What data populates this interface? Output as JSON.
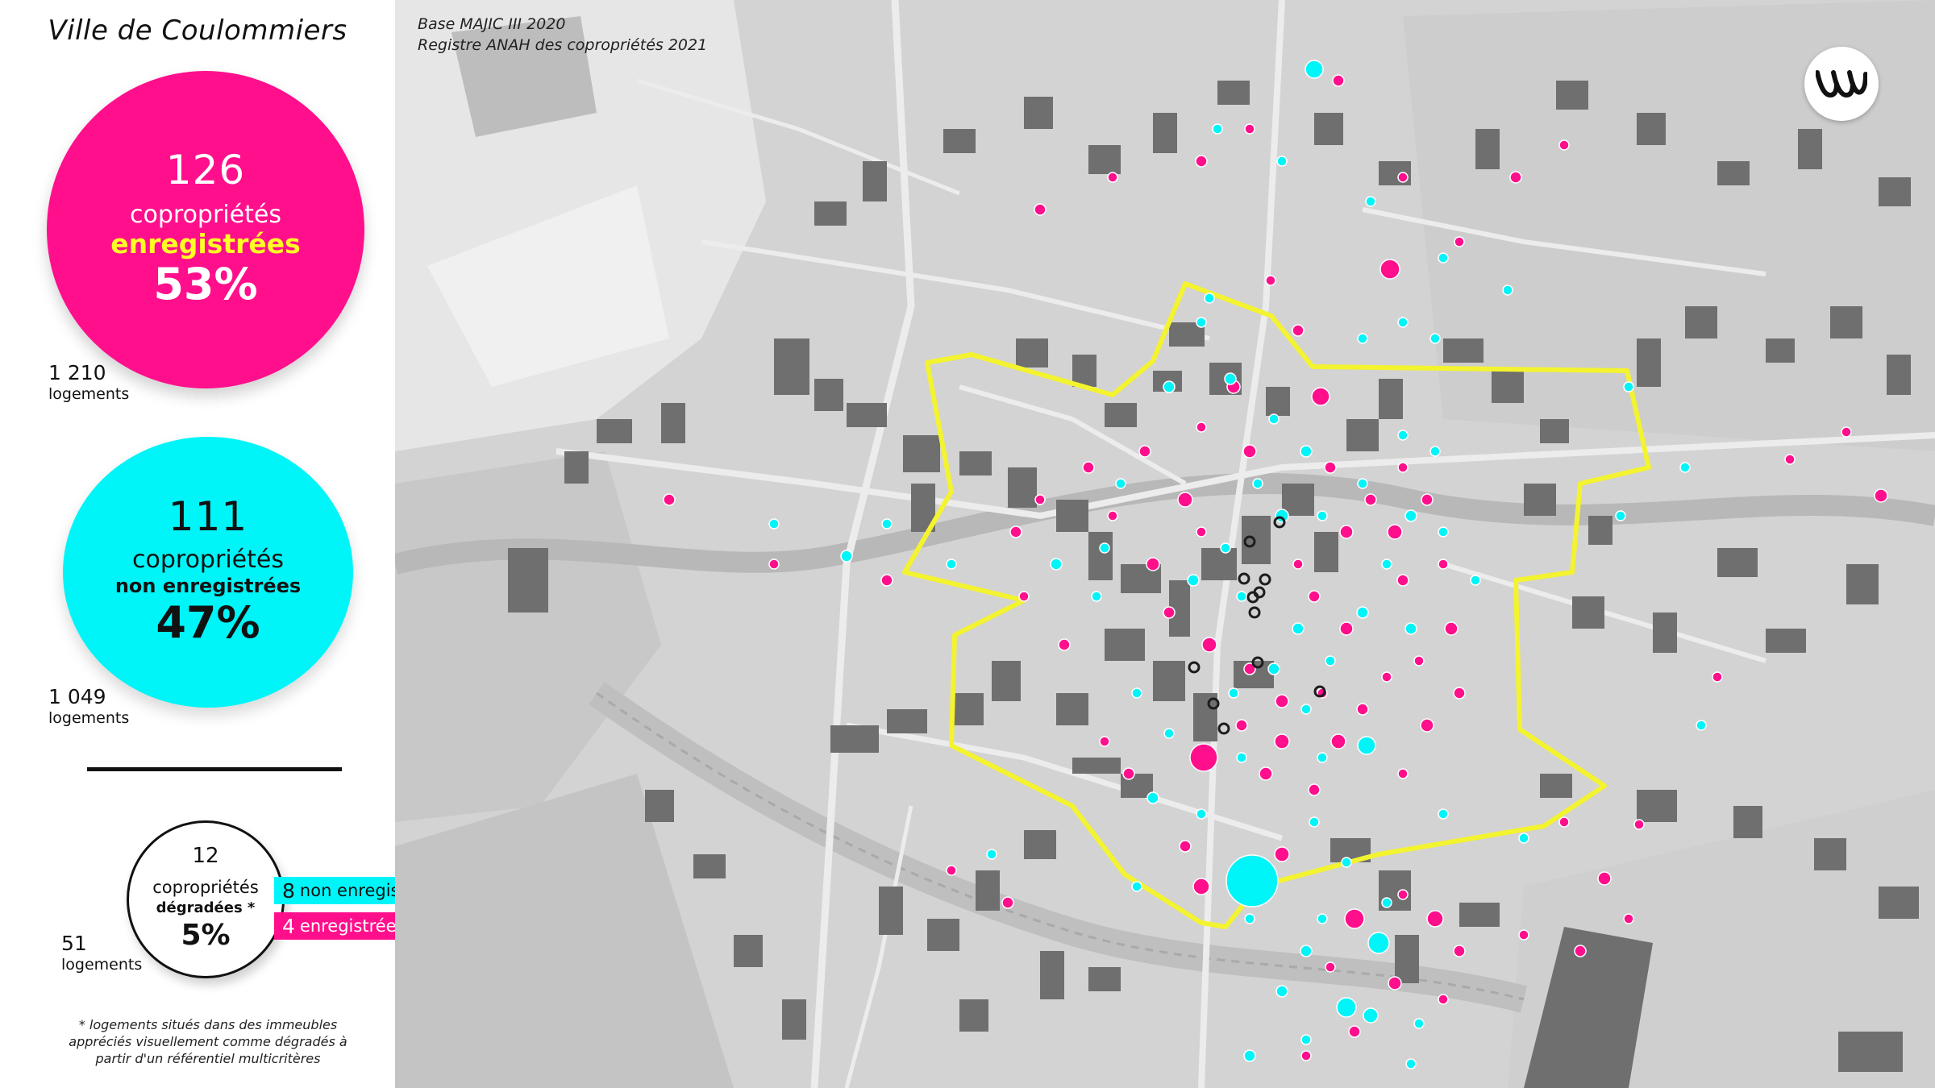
{
  "title": "Ville de Coulommiers",
  "source": {
    "line1": "Base MAJIC III 2020",
    "line2": "Registre ANAH des copropriétés 2021"
  },
  "registered": {
    "count": "126",
    "label1": "copropriétés",
    "label2": "enregistrées",
    "percent": "53%",
    "logements_count": "1 210",
    "logements_label": "logements",
    "color": "#ff0f8c"
  },
  "non_registered": {
    "count": "111",
    "label1": "copropriétés",
    "label2": "non enregistrées",
    "percent": "47%",
    "logements_count": "1 049",
    "logements_label": "logements",
    "color": "#00f5f8"
  },
  "degraded": {
    "count": "12",
    "label1": "copropriétés",
    "label2": "dégradées *",
    "percent": "5%",
    "logements_count": "51",
    "logements_label": "logements",
    "breakdown": [
      {
        "num": "8",
        "label": "non enregistrées",
        "color": "#00f5f8"
      },
      {
        "num": "4",
        "label": "enregistrées",
        "color": "#ff0f8c"
      }
    ]
  },
  "footnote": "* logements situés dans des immeubles appréciés visuellement comme dégradés à partir d'un référentiel multicritères",
  "map": {
    "perimeter_color": "#f3f330",
    "logo_icon": "agency-logo-icon"
  }
}
